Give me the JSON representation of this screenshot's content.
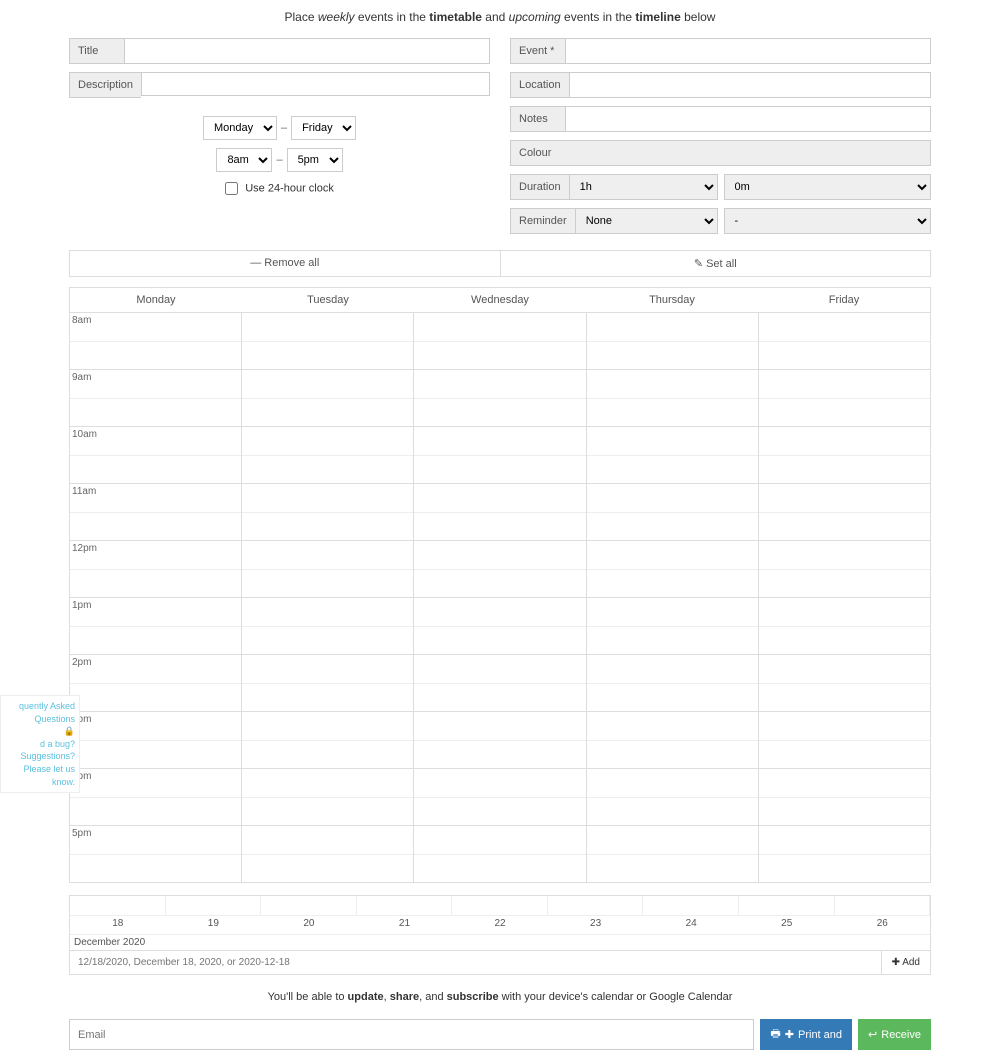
{
  "instruction": {
    "pre": "Place ",
    "em1": "weekly",
    "mid1": " events in the ",
    "b1": "timetable",
    "mid2": " and ",
    "em2": "upcoming",
    "mid3": " events in the ",
    "b2": "timeline",
    "post": " below"
  },
  "left": {
    "title_label": "Title",
    "desc_label": "Description",
    "day_from": "Monday",
    "day_to": "Friday",
    "time_from": "8am",
    "time_to": "5pm",
    "clock_label": "Use 24-hour clock"
  },
  "right": {
    "event_label": "Event *",
    "location_label": "Location",
    "notes_label": "Notes",
    "colour_label": "Colour",
    "duration_label": "Duration",
    "duration_h": "1h",
    "duration_m": "0m",
    "reminder_label": "Reminder",
    "reminder_val": "None",
    "reminder_unit": "-"
  },
  "buttons": {
    "remove_all": "Remove all",
    "set_all": "Set all"
  },
  "timetable": {
    "days": [
      "Monday",
      "Tuesday",
      "Wednesday",
      "Thursday",
      "Friday"
    ],
    "hours": [
      "8am",
      "9am",
      "10am",
      "11am",
      "12pm",
      "1pm",
      "2pm",
      "3pm",
      "4pm",
      "5pm"
    ]
  },
  "timeline": {
    "dates": [
      "18",
      "19",
      "20",
      "21",
      "22",
      "23",
      "24",
      "25",
      "26"
    ],
    "month": "December 2020",
    "placeholder": "12/18/2020, December 18, 2020, or 2020-12-18",
    "add": "Add"
  },
  "footer": {
    "pre": "You'll be able to ",
    "b1": "update",
    "s1": ", ",
    "b2": "share",
    "s2": ", and ",
    "b3": "subscribe",
    "post": " with your device's calendar or Google Calendar"
  },
  "email": {
    "placeholder": "Email",
    "print": "Print and",
    "receive": "Receive"
  },
  "side": {
    "faq": "quently Asked Questions",
    "bug": "d a bug? Suggestions? Please let us know."
  },
  "sep": "–"
}
